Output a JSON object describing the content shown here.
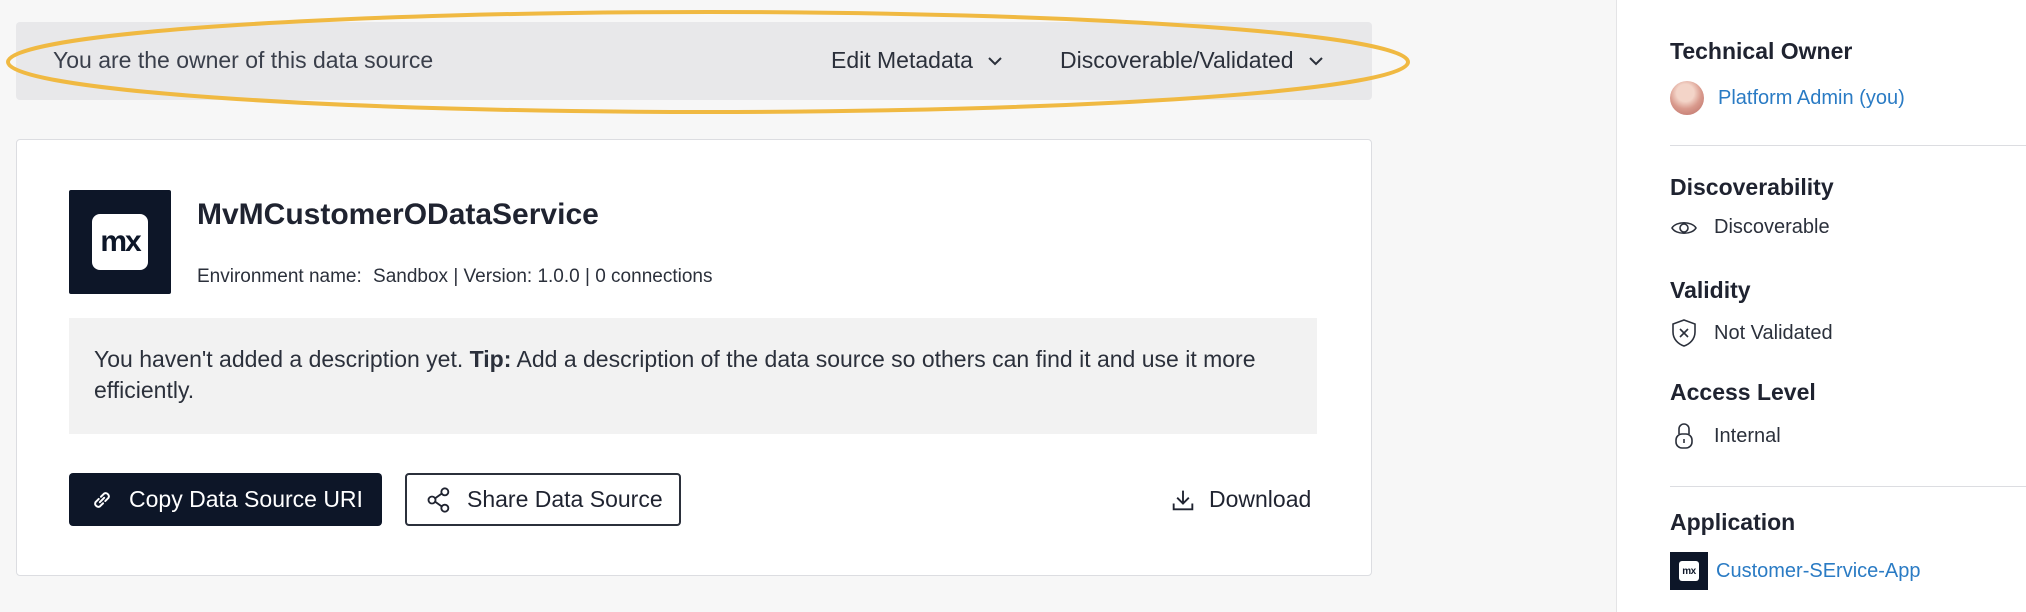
{
  "owner_bar": {
    "text": "You are the owner of this data source",
    "edit_metadata_label": "Edit Metadata",
    "status_dropdown_label": "Discoverable/Validated"
  },
  "card": {
    "logo_text": "mx",
    "title": "MvMCustomerODataService",
    "meta": {
      "env_label": "Environment name:",
      "env_value": "Sandbox | Version: 1.0.0 | 0 connections"
    },
    "description": {
      "prefix": "You haven't added a description yet. ",
      "tip_label": "Tip:",
      "tip_text": " Add a description of the data source so others can find it and use it more efficiently."
    },
    "buttons": {
      "copy_uri": "Copy Data Source URI",
      "share": "Share Data Source",
      "download": "Download"
    }
  },
  "sidebar": {
    "technical_owner_heading": "Technical Owner",
    "owner_name": "Platform Admin (you)",
    "discoverability_heading": "Discoverability",
    "discoverability_value": "Discoverable",
    "validity_heading": "Validity",
    "validity_value": "Not Validated",
    "access_heading": "Access Level",
    "access_value": "Internal",
    "application_heading": "Application",
    "application_logo_text": "mx",
    "application_name": "Customer-SErvice-App"
  },
  "colors": {
    "highlight": "#f0b942",
    "primary_dark": "#0d1628",
    "link": "#2a7bc4"
  }
}
